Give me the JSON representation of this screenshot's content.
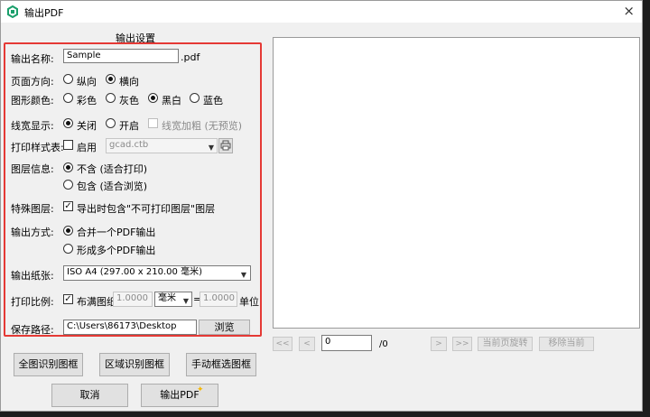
{
  "window": {
    "title": "输出PDF",
    "close_icon": "×"
  },
  "section_title": "输出设置",
  "output_name": {
    "label": "输出名称:",
    "value": "Sample",
    "ext": ".pdf"
  },
  "orientation": {
    "label": "页面方向:",
    "options": [
      "纵向",
      "横向"
    ],
    "selected": "横向"
  },
  "color": {
    "label": "图形颜色:",
    "options": [
      "彩色",
      "灰色",
      "黑白",
      "蓝色"
    ],
    "selected": "黑白"
  },
  "lineweight": {
    "label": "线宽显示:",
    "options": [
      "关闭",
      "开启"
    ],
    "selected": "关闭",
    "bold_label": "线宽加粗 (无预览)"
  },
  "plot_style": {
    "label": "打印样式表:",
    "enable_label": "启用",
    "enabled": false,
    "value": "gcad.ctb"
  },
  "layer_info": {
    "label": "图层信息:",
    "options": [
      "不含 (适合打印)",
      "包含 (适合浏览)"
    ],
    "selected": "不含 (适合打印)"
  },
  "special_layer": {
    "label": "特殊图层:",
    "check_label": "导出时包含\"不可打印图层\"图层",
    "checked": true
  },
  "output_mode": {
    "label": "输出方式:",
    "options": [
      "合并一个PDF输出",
      "形成多个PDF输出"
    ],
    "selected": "合并一个PDF输出"
  },
  "paper": {
    "label": "输出纸张:",
    "value": "ISO A4 (297.00 x 210.00 毫米)"
  },
  "scale": {
    "label": "打印比例:",
    "fit_label": "布满图纸",
    "checked": true,
    "value1": "1.0000",
    "unit": "毫米",
    "equals": "=",
    "value2": "1.0000",
    "unit_label": "单位"
  },
  "save_path": {
    "label": "保存路径:",
    "value": "C:\\Users\\86173\\Desktop",
    "browse": "浏览"
  },
  "buttons": {
    "full_detect": "全图识别图框",
    "area_detect": "区域识别图框",
    "manual_select": "手动框选图框",
    "cancel": "取消",
    "export": "输出PDF"
  },
  "nav": {
    "first": "<<",
    "prev": "<",
    "page": "0",
    "total": "/0",
    "next": ">",
    "last": ">>",
    "rotate": "当前页旋转",
    "remove": "移除当前"
  },
  "colors": {
    "highlight": "#e53935",
    "star": "#f5b700"
  }
}
